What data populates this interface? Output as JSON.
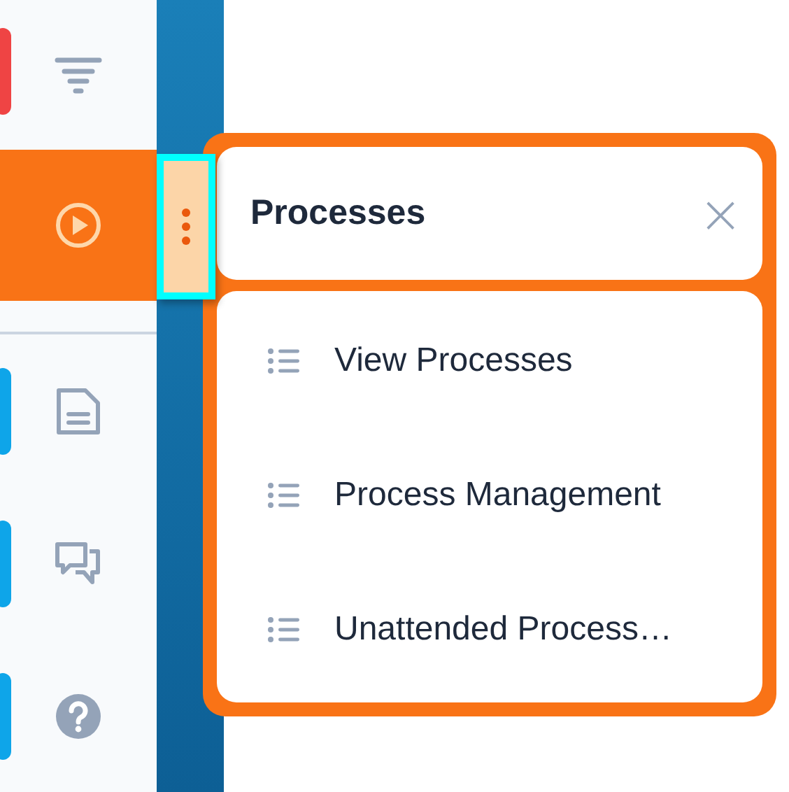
{
  "sidebar": {
    "items": [
      {
        "kind": "filter",
        "selected": false,
        "color": "#ef4444"
      },
      {
        "kind": "play",
        "selected": true
      },
      {
        "kind": "document",
        "selected": false,
        "color": "#0ea5e9"
      },
      {
        "kind": "chat",
        "selected": false,
        "color": "#0ea5e9"
      },
      {
        "kind": "help",
        "selected": false,
        "color": "#0ea5e9"
      }
    ]
  },
  "handle": {
    "highlighted": true
  },
  "popover": {
    "title": "Processes",
    "close": "×",
    "items": [
      {
        "label": "View Processes"
      },
      {
        "label": "Process Management"
      },
      {
        "label": "Unattended Process…"
      }
    ]
  }
}
